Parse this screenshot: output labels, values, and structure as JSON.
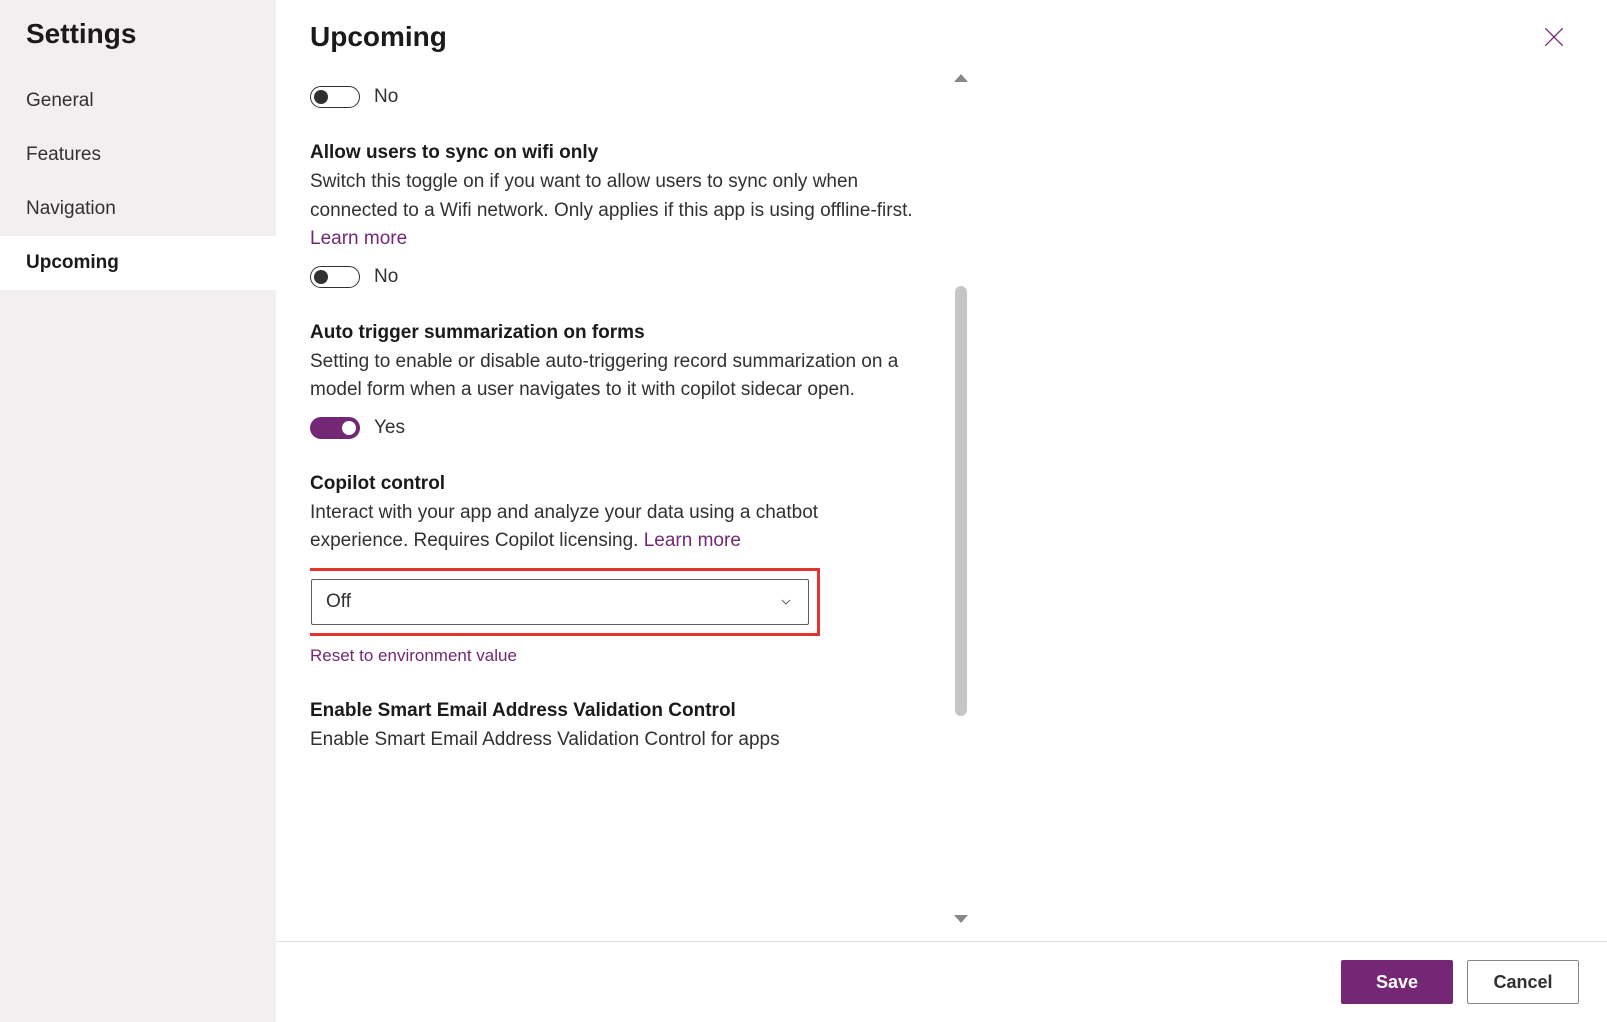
{
  "sidebar": {
    "title": "Settings",
    "items": [
      {
        "label": "General",
        "active": false
      },
      {
        "label": "Features",
        "active": false
      },
      {
        "label": "Navigation",
        "active": false
      },
      {
        "label": "Upcoming",
        "active": true
      }
    ]
  },
  "header": {
    "title": "Upcoming"
  },
  "toggle_labels": {
    "yes": "Yes",
    "no": "No"
  },
  "settings": {
    "orphan_toggle": {
      "value": "No"
    },
    "wifi_sync": {
      "title": "Allow users to sync on wifi only",
      "desc": "Switch this toggle on if you want to allow users to sync only when connected to a Wifi network. Only applies if this app is using offline-first. ",
      "learn_more": "Learn more",
      "value": "No"
    },
    "auto_summarization": {
      "title": "Auto trigger summarization on forms",
      "desc": "Setting to enable or disable auto-triggering record summarization on a model form when a user navigates to it with copilot sidecar open.",
      "value": "Yes"
    },
    "copilot_control": {
      "title": "Copilot control",
      "desc": "Interact with your app and analyze your data using a chatbot experience. Requires Copilot licensing. ",
      "learn_more": "Learn more",
      "selected": "Off",
      "reset_link": "Reset to environment value"
    },
    "smart_email": {
      "title": "Enable Smart Email Address Validation Control",
      "desc": "Enable Smart Email Address Validation Control for apps"
    }
  },
  "footer": {
    "save": "Save",
    "cancel": "Cancel"
  },
  "colors": {
    "accent": "#742774",
    "highlight": "#e3352e"
  }
}
